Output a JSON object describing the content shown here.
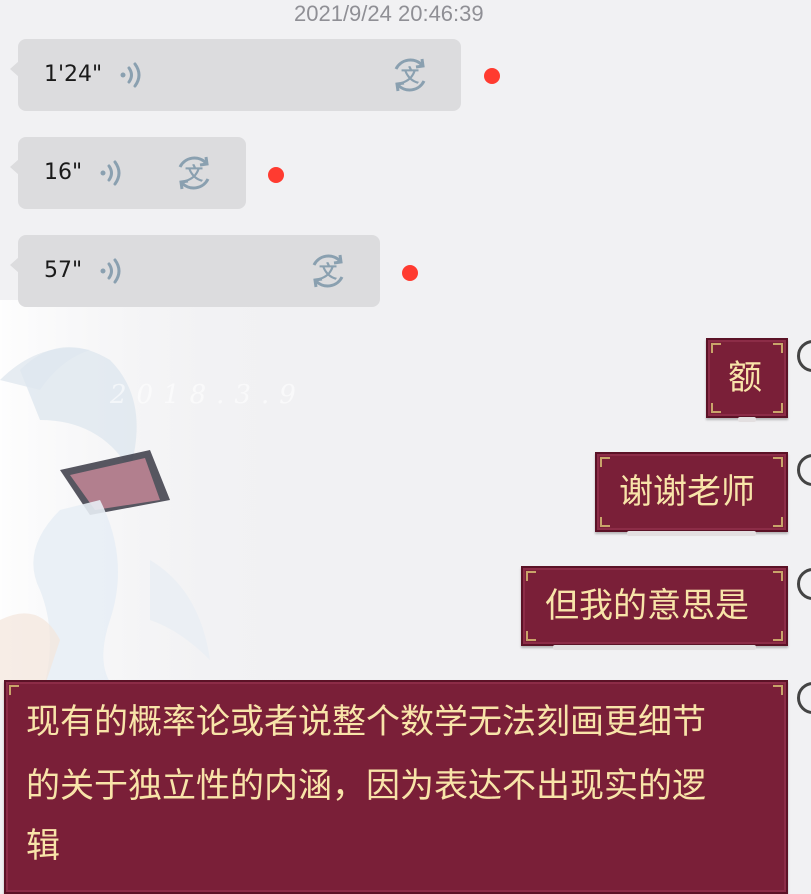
{
  "chat": {
    "timestamp": "2021/9/24 20:46:39",
    "voice_messages": [
      {
        "duration": "1'24\"",
        "wave_icon": "voice-wave-icon",
        "translate_icon": "speech-to-text-icon",
        "unread": true
      },
      {
        "duration": "16\"",
        "wave_icon": "voice-wave-icon",
        "translate_icon": "speech-to-text-icon",
        "unread": true
      },
      {
        "duration": "57\"",
        "wave_icon": "voice-wave-icon",
        "translate_icon": "speech-to-text-icon",
        "unread": true
      }
    ],
    "sent_messages": [
      {
        "lines": [
          "额"
        ]
      },
      {
        "lines": [
          "谢谢老师"
        ]
      },
      {
        "lines": [
          "但我的意思是"
        ]
      },
      {
        "lines": [
          "现有的概率论或者说整个数学无法刻画更细节",
          "的关于独立性的内涵，因为表达不出现实的逻",
          "辑"
        ]
      }
    ],
    "background_signature": "2018.3.9"
  },
  "colors": {
    "background": "#f1f1f3",
    "voice_bubble": "#dcdcde",
    "sent_bubble": "#7a1f38",
    "sent_text": "#f8e4a9",
    "unread_dot": "#ff3b30",
    "icon": "#8aa0b0"
  }
}
